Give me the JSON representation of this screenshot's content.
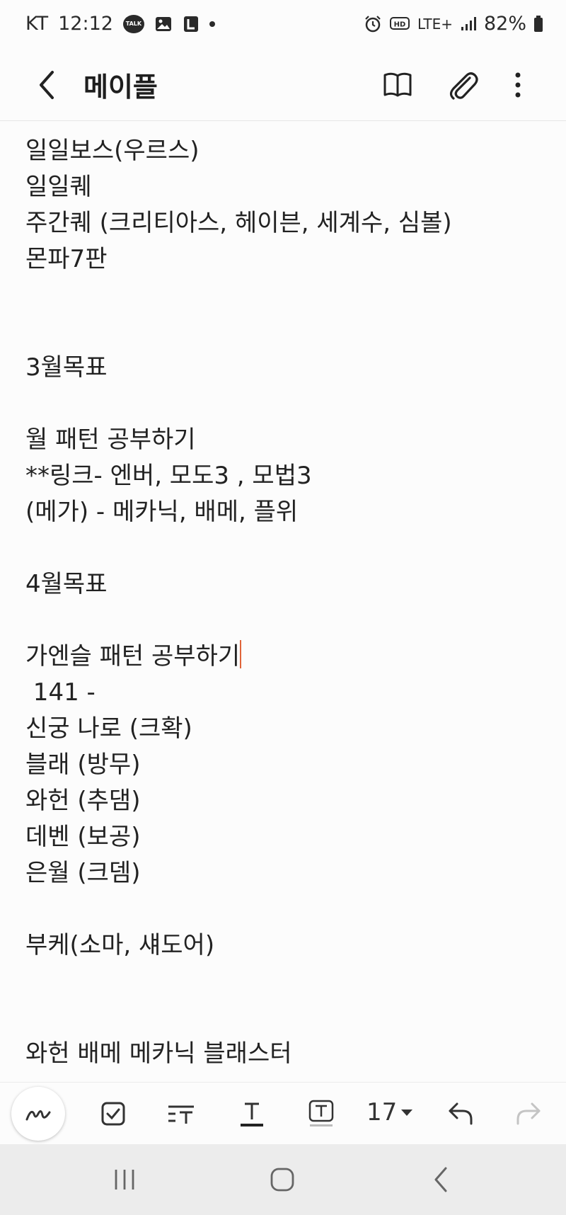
{
  "status_bar": {
    "carrier": "KT",
    "time": "12:12",
    "talk_badge": "TALK",
    "network": "LTE+",
    "battery": "82%"
  },
  "app_bar": {
    "title": "메이플"
  },
  "note": {
    "lines": [
      "일일보스(우르스)",
      "일일퀘",
      "주간퀘 (크리티아스, 헤이븐, 세계수, 심볼)",
      "몬파7판",
      "",
      "",
      "3월목표",
      "",
      "월 패턴 공부하기",
      "**링크- 엔버, 모도3 , 모법3",
      "(메가) - 메카닉, 배메, 플위",
      "",
      "4월목표",
      "",
      "가엔슬 패턴 공부하기",
      " 141 -",
      "신궁 나로 (크확)",
      "블래 (방무)",
      "와헌 (추댐)",
      "데벤 (보공)",
      "은월 (크뎀)",
      "",
      "부케(소마, 섀도어)",
      "",
      "",
      "와헌 배메 메카닉 블래스터"
    ]
  },
  "toolbar": {
    "font_size": "17"
  },
  "colors": {
    "cursor": "#e0643a",
    "background": "#fcfcfc",
    "nav_background": "#ececec"
  }
}
